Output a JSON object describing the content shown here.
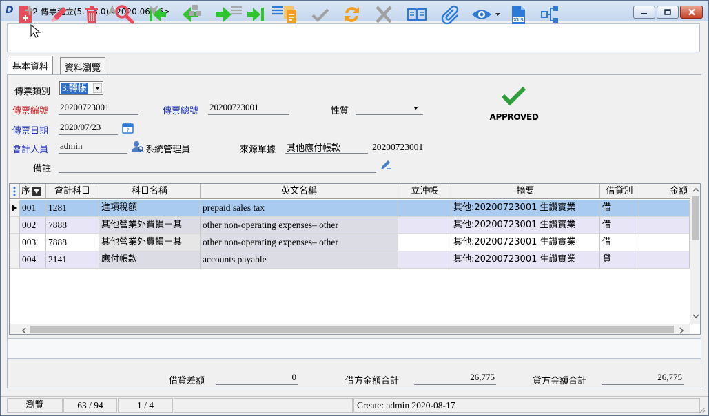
{
  "window": {
    "title": "IB02 傳票建立(5.1.3.0)<2020.06.16>",
    "app_logo": "D"
  },
  "toolbar": {
    "buttons": [
      {
        "name": "new-document",
        "icon": "new-document-icon",
        "color": "#e84c5a"
      },
      {
        "name": "edit",
        "icon": "pencil-icon",
        "color": "#e84c5a"
      },
      {
        "name": "delete",
        "icon": "trash-icon",
        "color": "#e84c5a"
      },
      {
        "name": "search",
        "icon": "magnifier-icon",
        "color": "#e84c5a"
      },
      {
        "name": "first",
        "icon": "first-record-icon",
        "color": "#31c431"
      },
      {
        "name": "previous",
        "icon": "previous-arrow-icon",
        "color": "#31c431"
      },
      {
        "name": "next",
        "icon": "next-arrow-icon",
        "color": "#31c431"
      },
      {
        "name": "last",
        "icon": "last-record-icon",
        "color": "#31c431"
      },
      {
        "name": "copy",
        "icon": "copy-document-icon",
        "color": "#f0a020"
      },
      {
        "name": "confirm",
        "icon": "checkmark-icon",
        "color": "#a0a0a0"
      },
      {
        "name": "refresh",
        "icon": "refresh-icon",
        "color": "#f0a020"
      },
      {
        "name": "cancel",
        "icon": "x-icon",
        "color": "#a0a0a0"
      },
      {
        "name": "book",
        "icon": "open-book-icon",
        "color": "#2d7ad6"
      },
      {
        "name": "attachment",
        "icon": "paperclip-icon",
        "color": "#2d7ad6"
      },
      {
        "name": "view",
        "icon": "eye-icon",
        "color": "#2d7ad6"
      },
      {
        "name": "export-xls",
        "icon": "xls-file-icon",
        "color": "#2d7ad6"
      },
      {
        "name": "flow",
        "icon": "flowchart-icon",
        "color": "#2d7ad6"
      }
    ],
    "xls_text": "XLS"
  },
  "tabs": [
    {
      "label": "基本資料",
      "active": true
    },
    {
      "label": "資料瀏覽",
      "active": false
    }
  ],
  "form": {
    "voucher_type_label": "傳票類別",
    "voucher_type_value": "3.轉帳",
    "voucher_no_label": "傳票編號",
    "voucher_no_value": "20200723001",
    "voucher_total_no_label": "傳票總號",
    "voucher_total_no_value": "20200723001",
    "nature_label": "性質",
    "nature_value": "",
    "voucher_date_label": "傳票日期",
    "voucher_date_value": "2020/07/23",
    "accountant_label": "會計人員",
    "accountant_value": "admin",
    "accountant_name": "系統管理員",
    "source_doc_label": "來源單據",
    "source_doc_value": "其他應付帳款",
    "source_doc_no": "20200723001",
    "remark_label": "備註",
    "remark_value": "",
    "approved_text": "APPROVED",
    "approved_color": "#2e9e3a"
  },
  "grid": {
    "columns": [
      "序",
      "會計科目",
      "科目名稱",
      "英文名稱",
      "立沖帳",
      "摘要",
      "借貸別",
      "金額"
    ],
    "rows": [
      {
        "seq": "001",
        "account": "1281",
        "name": "進項稅額",
        "english": "prepaid sales tax",
        "offset": "",
        "summary": "其他:20200723001 生讚實業",
        "dc": "借",
        "amount": ""
      },
      {
        "seq": "002",
        "account": "7888",
        "name": "其他營業外費損－其",
        "english": "other non-operating expenses– other",
        "offset": "",
        "summary": "其他:20200723001 生讚實業",
        "dc": "借",
        "amount": ""
      },
      {
        "seq": "003",
        "account": "7888",
        "name": "其他營業外費損－其",
        "english": "other non-operating expenses– other",
        "offset": "",
        "summary": "其他:20200723001 生讚實業",
        "dc": "借",
        "amount": ""
      },
      {
        "seq": "004",
        "account": "2141",
        "name": "應付帳款",
        "english": "accounts payable",
        "offset": "",
        "summary": "其他:20200723001 生讚實業",
        "dc": "貸",
        "amount": ""
      }
    ],
    "selected_row_color": "#a9cbf0",
    "alt_row_color": "#e8e6f6"
  },
  "totals": {
    "diff_label": "借貸差額",
    "diff_value": "0",
    "debit_label": "借方金額合計",
    "debit_value": "26,775",
    "credit_label": "貸方金額合計",
    "credit_value": "26,775"
  },
  "status": {
    "mode": "瀏覽",
    "record": "63 / 94",
    "page": "1 / 4",
    "created": "Create: admin 2020-08-17"
  }
}
